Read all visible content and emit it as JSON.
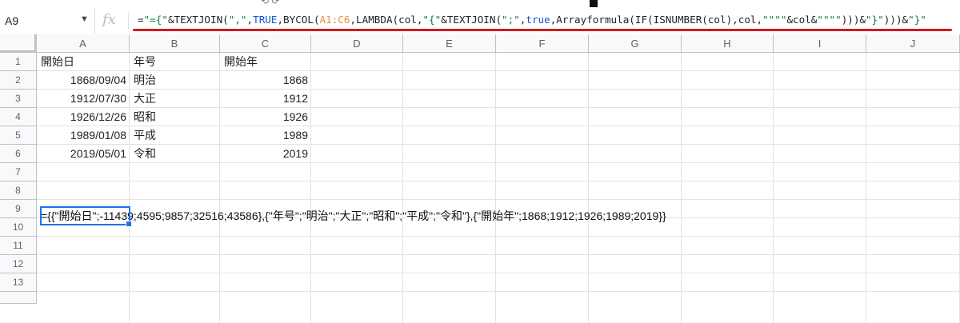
{
  "formula_bar": {
    "cell_ref": "A9",
    "fx_label": "fx",
    "formula_parts": [
      {
        "t": "=",
        "c": ""
      },
      {
        "t": "\"={\"",
        "c": "str"
      },
      {
        "t": "&TEXTJOIN(",
        "c": ""
      },
      {
        "t": "\",\"",
        "c": "str"
      },
      {
        "t": ",",
        "c": ""
      },
      {
        "t": "TRUE",
        "c": "kw"
      },
      {
        "t": ",BYCOL(",
        "c": ""
      },
      {
        "t": "A1:C6",
        "c": "rng"
      },
      {
        "t": ",LAMBDA(col,",
        "c": ""
      },
      {
        "t": "\"{\"",
        "c": "str"
      },
      {
        "t": "&TEXTJOIN(",
        "c": ""
      },
      {
        "t": "\";\"",
        "c": "str"
      },
      {
        "t": ",",
        "c": ""
      },
      {
        "t": "true",
        "c": "kw"
      },
      {
        "t": ",Arrayformula(IF(ISNUMBER(col),col,",
        "c": ""
      },
      {
        "t": "\"\"\"\"",
        "c": "str"
      },
      {
        "t": "&col&",
        "c": ""
      },
      {
        "t": "\"\"\"\"",
        "c": "str"
      },
      {
        "t": ")))&",
        "c": ""
      },
      {
        "t": "\"}\"",
        "c": "str"
      },
      {
        "t": ")))&",
        "c": ""
      },
      {
        "t": "\"}\"",
        "c": "str"
      }
    ]
  },
  "columns": [
    "A",
    "B",
    "C",
    "D",
    "E",
    "F",
    "G",
    "H",
    "I",
    "J"
  ],
  "rows": [
    "1",
    "2",
    "3",
    "4",
    "5",
    "6",
    "7",
    "8",
    "9",
    "10",
    "11",
    "12",
    "13"
  ],
  "cells": {
    "row1": [
      "開始日",
      "年号",
      "開始年"
    ],
    "row2": [
      "1868/09/04",
      "明治",
      "1868"
    ],
    "row3": [
      "1912/07/30",
      "大正",
      "1912"
    ],
    "row4": [
      "1926/12/26",
      "昭和",
      "1926"
    ],
    "row5": [
      "1989/01/08",
      "平成",
      "1989"
    ],
    "row6": [
      "2019/05/01",
      "令和",
      "2019"
    ],
    "a9": "={{\"開始日\";-11439;4595;9857;32516;43586},{\"年号\";\"明治\";\"大正\";\"昭和\";\"平成\";\"令和\"},{\"開始年\";1868;1912;1926;1989;2019}}"
  },
  "colors": {
    "selection": "#1a73e8",
    "annotation_underline": "#d11a1a",
    "string_token": "#0b8043",
    "keyword_token": "#1155cc",
    "range_token": "#e69138"
  }
}
